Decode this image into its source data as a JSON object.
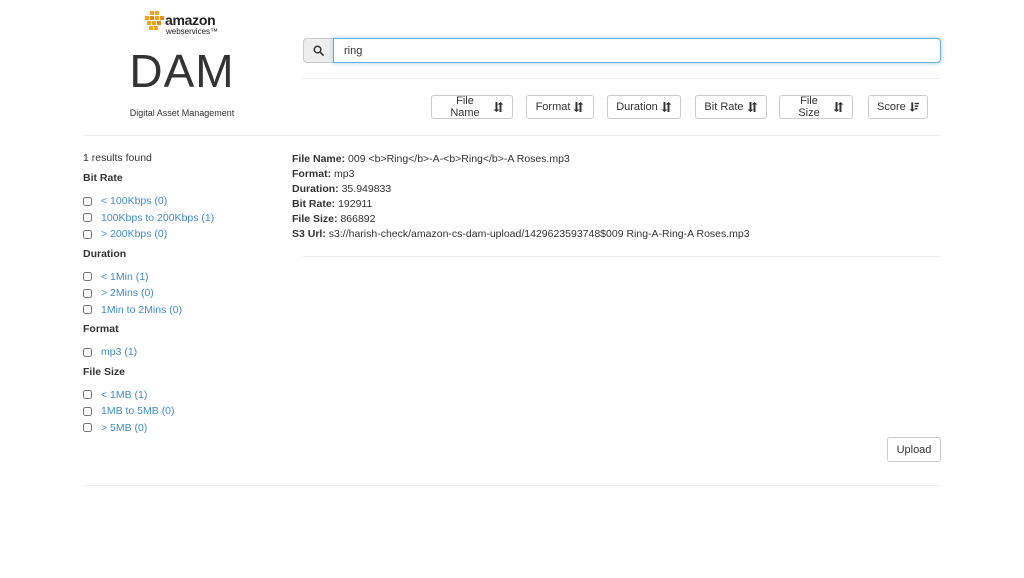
{
  "header": {
    "logo_word": "amazon",
    "logo_sub": "webservices™",
    "brand": "DAM",
    "tagline": "Digital Asset Management"
  },
  "search": {
    "value": "ring",
    "icon": "search-icon"
  },
  "sort_buttons": [
    {
      "label": "File Name",
      "icon": "sort-icon"
    },
    {
      "label": "Format",
      "icon": "sort-icon"
    },
    {
      "label": "Duration",
      "icon": "sort-icon"
    },
    {
      "label": "Bit Rate",
      "icon": "sort-icon"
    },
    {
      "label": "File Size",
      "icon": "sort-icon"
    },
    {
      "label": "Score",
      "icon": "sort-amount-desc-icon"
    }
  ],
  "sidebar": {
    "results_count": "1 results found",
    "facets": [
      {
        "title": "Bit Rate",
        "items": [
          "< 100Kbps (0)",
          "100Kbps to 200Kbps (1)",
          "> 200Kbps (0)"
        ]
      },
      {
        "title": "Duration",
        "items": [
          "< 1Min (1)",
          "> 2Mins (0)",
          "1Min to 2Mins (0)"
        ]
      },
      {
        "title": "Format",
        "items": [
          "mp3 (1)"
        ]
      },
      {
        "title": "File Size",
        "items": [
          "< 1MB (1)",
          "1MB to 5MB (0)",
          "> 5MB (0)"
        ]
      }
    ]
  },
  "result": {
    "file_name_label": "File Name:",
    "file_name": "009 <b>Ring</b>-A-<b>Ring</b>-A Roses.mp3",
    "format_label": "Format:",
    "format": "mp3",
    "duration_label": "Duration:",
    "duration": "35.949833",
    "bit_rate_label": "Bit Rate:",
    "bit_rate": "192911",
    "file_size_label": "File Size:",
    "file_size": "866892",
    "s3_url_label": "S3 Url:",
    "s3_url": "s3://harish-check/amazon-cs-dam-upload/1429623593748$009 Ring-A-Ring-A Roses.mp3"
  },
  "upload_label": "Upload"
}
